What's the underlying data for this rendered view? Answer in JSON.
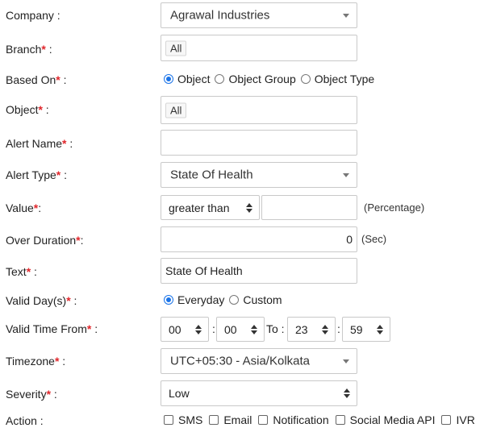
{
  "company": {
    "label": "Company :",
    "value": "Agrawal Industries"
  },
  "branch": {
    "label": "Branch",
    "suffix": " :",
    "tag": "All"
  },
  "based_on": {
    "label": "Based On",
    "suffix": " :",
    "options": [
      "Object",
      "Object Group",
      "Object Type"
    ],
    "selected": "Object"
  },
  "object": {
    "label": "Object",
    "suffix": " :",
    "tag": "All"
  },
  "alert_name": {
    "label": "Alert Name",
    "suffix": " :",
    "value": ""
  },
  "alert_type": {
    "label": "Alert Type",
    "suffix": " :",
    "value": "State Of Health"
  },
  "value": {
    "label": "Value",
    "suffix": ":",
    "operator": "greater than",
    "amount": "",
    "unit": "(Percentage)"
  },
  "over_duration": {
    "label": "Over Duration",
    "suffix": ":",
    "value": "0",
    "unit": "(Sec)"
  },
  "text": {
    "label": "Text",
    "suffix": " :",
    "value": "State Of Health"
  },
  "valid_days": {
    "label": "Valid Day(s)",
    "suffix": " :",
    "options": [
      "Everyday",
      "Custom"
    ],
    "selected": "Everyday"
  },
  "valid_time": {
    "label": "Valid Time From",
    "suffix": " :",
    "from_h": "00",
    "from_m": "00",
    "to_label": "To :",
    "to_h": "23",
    "to_m": "59",
    "sep": ":"
  },
  "timezone": {
    "label": "Timezone",
    "suffix": " :",
    "value": "UTC+05:30 - Asia/Kolkata"
  },
  "severity": {
    "label": "Severity",
    "suffix": " :",
    "value": "Low"
  },
  "action": {
    "label": "Action :",
    "options": [
      "SMS",
      "Email",
      "Notification",
      "Social Media API",
      "IVR"
    ]
  },
  "required_mark": "*",
  "colors": {
    "required": "#e0262b",
    "radio_accent": "#1a73e8",
    "border": "#c9c9c9"
  }
}
